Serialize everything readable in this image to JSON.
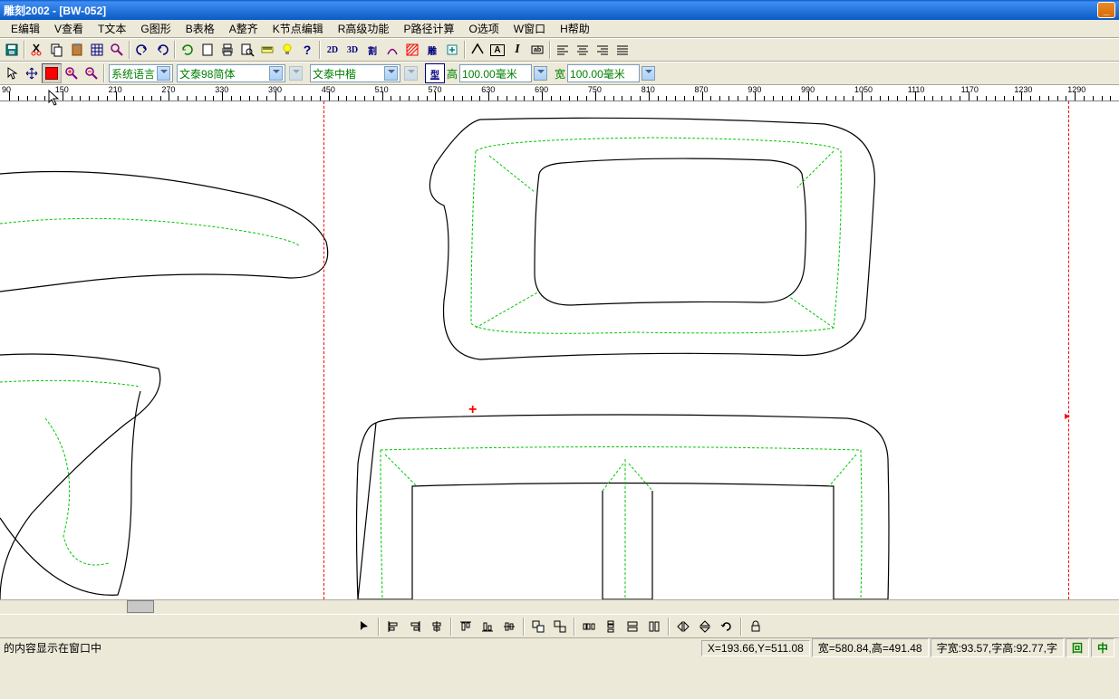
{
  "title": "雕刻2002 - [BW-052]",
  "menu": {
    "edit": "E编辑",
    "view": "V查看",
    "text": "T文本",
    "graphics": "G图形",
    "table": "B表格",
    "align": "A整齐",
    "node": "K节点编辑",
    "advanced": "R高级功能",
    "path": "P路径计算",
    "options": "O选项",
    "window": "W窗口",
    "help": "H帮助"
  },
  "toolbar": {
    "btn2d": "2D",
    "btn3d": "3D",
    "btnCut": "割",
    "btnEngrave": "雕"
  },
  "textbar": {
    "lang": "系统语言",
    "font1": "文泰98简体",
    "font2": "文泰中楷",
    "typeBtn": "型",
    "heightLabel": "高",
    "heightValue": "100.00毫米",
    "widthLabel": "宽",
    "widthValue": "100.00毫米"
  },
  "ruler": {
    "ticks": [
      "90",
      "150",
      "210",
      "270",
      "330",
      "390",
      "450",
      "510",
      "570",
      "630",
      "690",
      "750",
      "810",
      "870",
      "930",
      "990",
      "1050",
      "1110",
      "1170",
      "1230",
      "1290"
    ]
  },
  "status": {
    "hint": "的内容显示在窗口中",
    "coords": "X=193.66,Y=511.08",
    "dims": "宽=580.84,高=491.48",
    "font": "字宽:93.57,字高:92.77,字",
    "btn1": "回",
    "btn2": "中"
  }
}
